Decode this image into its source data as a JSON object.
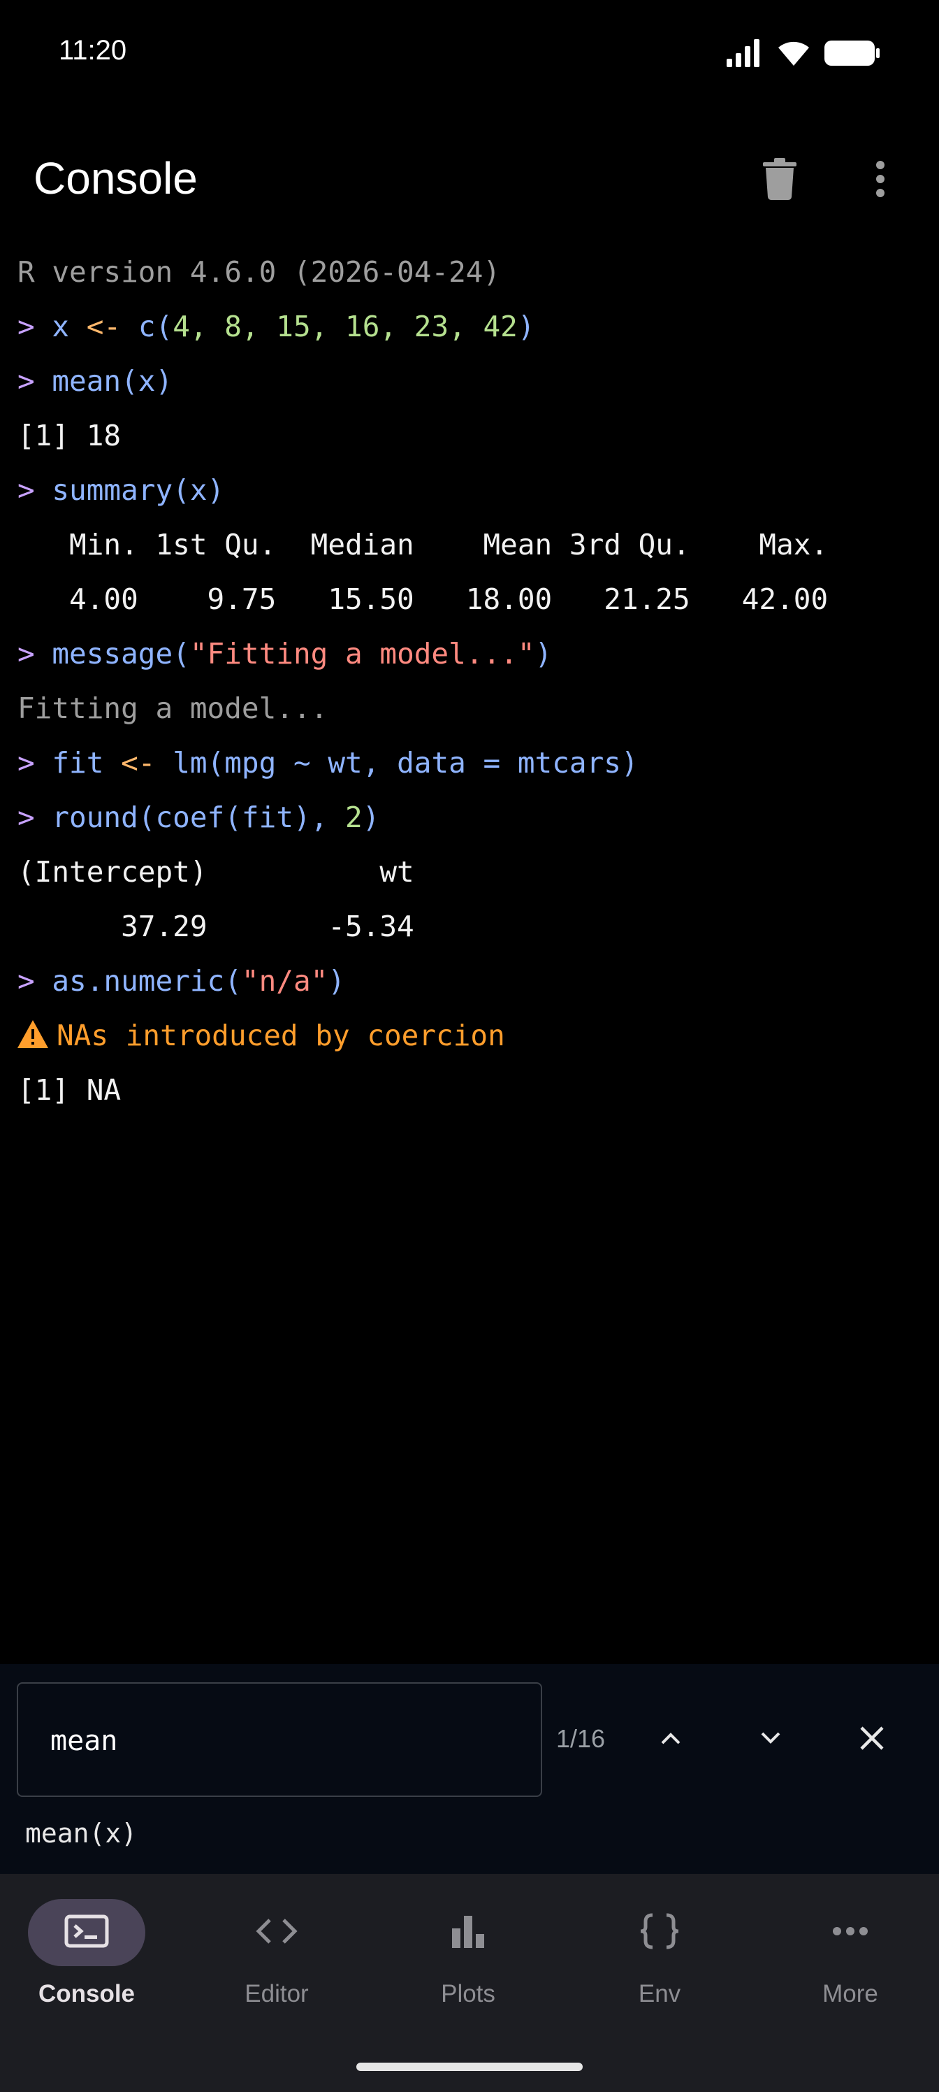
{
  "status_bar": {
    "time": "11:20",
    "icons": [
      "signal-icon",
      "wifi-icon",
      "battery-icon"
    ]
  },
  "app_bar": {
    "title": "Console",
    "actions": [
      "trash-icon",
      "more-vert-icon"
    ]
  },
  "console": {
    "version_line": "R version 4.6.0 (2026-04-24)",
    "prompt": ">",
    "lines": {
      "cmd1": {
        "var": "x",
        "op": "<-",
        "fn": "c(",
        "args": "4, 8, 15, 16, 23, 42",
        "close": ")"
      },
      "cmd2": "mean(x)",
      "out2": "[1] 18",
      "cmd3": "summary(x)",
      "out3_header": "   Min. 1st Qu.  Median    Mean 3rd Qu.    Max. ",
      "out3_values": "   4.00    9.75   15.50   18.00   21.25   42.00 ",
      "cmd4": {
        "fn": "message(",
        "string": "\"Fitting a model...\"",
        "close": ")"
      },
      "out4": "Fitting a model...",
      "cmd5": {
        "var": "fit",
        "op": "<-",
        "expr": "lm(mpg ~ wt, data = mtcars)"
      },
      "cmd6": {
        "fn": "round(coef(fit), ",
        "num": "2",
        "close": ")"
      },
      "out6_header": "(Intercept)          wt ",
      "out6_values": "      37.29       -5.34 ",
      "cmd7": {
        "fn": "as.numeric(",
        "string": "\"n/a\"",
        "close": ")"
      },
      "warning": "NAs introduced by coercion",
      "out7": "[1] NA"
    }
  },
  "search": {
    "query": "mean",
    "match_count": "1/16",
    "match_preview": "mean(x)",
    "buttons": [
      "chevron-up-icon",
      "chevron-down-icon",
      "close-icon"
    ]
  },
  "bottom_nav": {
    "items": [
      {
        "label": "Console",
        "icon": "terminal-icon",
        "active": true
      },
      {
        "label": "Editor",
        "icon": "code-icon",
        "active": false
      },
      {
        "label": "Plots",
        "icon": "bar-chart-icon",
        "active": false
      },
      {
        "label": "Env",
        "icon": "braces-icon",
        "active": false
      },
      {
        "label": "More",
        "icon": "more-horiz-icon",
        "active": false
      }
    ]
  },
  "colors": {
    "background": "#000000",
    "prompt": "#c8a2ff",
    "code": "#8fb4ff",
    "number": "#b5e08f",
    "string": "#ff8a80",
    "warning": "#ff9e2c",
    "nav_background": "#1c1d22",
    "nav_active_pill": "#4a4458"
  }
}
